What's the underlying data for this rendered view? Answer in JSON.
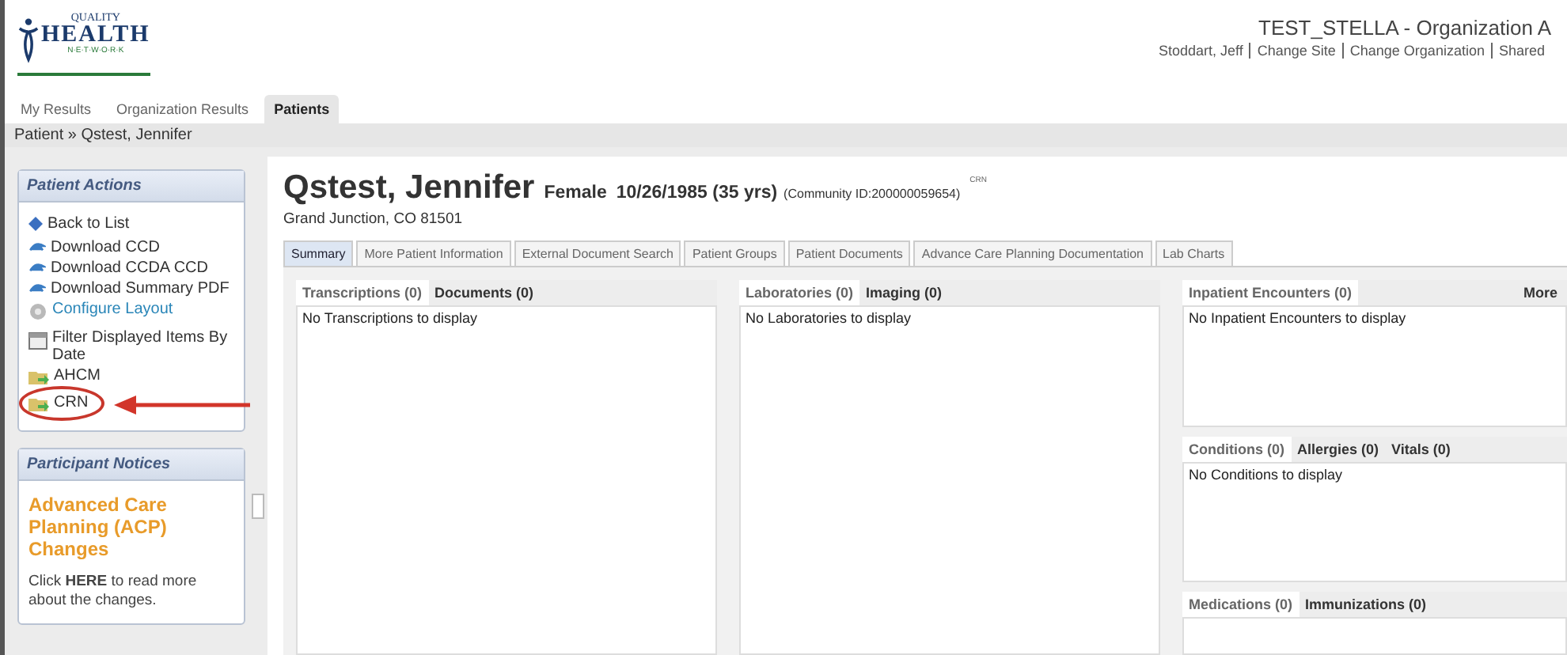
{
  "header": {
    "logo": {
      "top": "QUALITY",
      "middle": "HEALTH",
      "bottom": "N·E·T·W·O·R·K"
    },
    "org_title": "TEST_STELLA - Organization A",
    "user_links": [
      {
        "label": "Stoddart, Jeff"
      },
      {
        "label": "Change Site"
      },
      {
        "label": "Change Organization"
      },
      {
        "label": "Shared"
      }
    ]
  },
  "nav_tabs": [
    {
      "label": "My Results",
      "selected": false
    },
    {
      "label": "Organization Results",
      "selected": false
    },
    {
      "label": "Patients",
      "selected": true
    }
  ],
  "breadcrumb": "Patient » Qstest, Jennifer",
  "sidebar": {
    "actions": {
      "title": "Patient Actions",
      "items": [
        {
          "label": "Back to List",
          "kind": "diamond",
          "link": false,
          "highlighted": false
        },
        {
          "label": "Download CCD",
          "kind": "arrow",
          "link": false,
          "highlighted": false
        },
        {
          "label": "Download CCDA CCD",
          "kind": "arrow",
          "link": false,
          "highlighted": false
        },
        {
          "label": "Download Summary PDF",
          "kind": "arrow",
          "link": false,
          "highlighted": false
        },
        {
          "label": "Configure Layout",
          "kind": "gear",
          "link": true,
          "highlighted": false
        },
        {
          "label": "Filter Displayed Items By Date",
          "kind": "calendar",
          "link": false,
          "highlighted": false
        },
        {
          "label": "AHCM",
          "kind": "folder",
          "link": false,
          "highlighted": false
        },
        {
          "label": "CRN",
          "kind": "folder",
          "link": false,
          "highlighted": true
        }
      ]
    },
    "notices": {
      "title": "Participant Notices",
      "headline": "Advanced Care Planning (ACP) Changes",
      "body": "Click **HERE** to read more about the changes."
    }
  },
  "patient": {
    "name": "Qstest, Jennifer",
    "gender": "Female",
    "dob": "10/26/1985 (35 yrs)",
    "community_id": "(Community ID:200000059654)",
    "badge": "CRN",
    "address": "Grand Junction, CO 81501"
  },
  "tabs": [
    {
      "label": "Summary",
      "selected": true
    },
    {
      "label": "More Patient Information",
      "selected": false
    },
    {
      "label": "External Document Search",
      "selected": false
    },
    {
      "label": "Patient Groups",
      "selected": false
    },
    {
      "label": "Patient Documents",
      "selected": false
    },
    {
      "label": "Advance Care Planning Documentation",
      "selected": false
    },
    {
      "label": "Lab Charts",
      "selected": false
    }
  ],
  "columns": [
    [
      {
        "tabs": [
          {
            "label": "Transcriptions (0)",
            "selected": true
          },
          {
            "label": "Documents (0)",
            "selected": false
          }
        ],
        "empty_text": "No Transcriptions to display"
      }
    ],
    [
      {
        "tabs": [
          {
            "label": "Laboratories (0)",
            "selected": true
          },
          {
            "label": "Imaging (0)",
            "selected": false
          }
        ],
        "empty_text": "No Laboratories to display"
      }
    ],
    [
      {
        "tabs": [
          {
            "label": "Inpatient Encounters (0)",
            "selected": true
          }
        ],
        "more": "More",
        "empty_text": "No Inpatient Encounters to display"
      },
      {
        "tabs": [
          {
            "label": "Conditions (0)",
            "selected": true
          },
          {
            "label": "Allergies (0)",
            "selected": false
          },
          {
            "label": "Vitals (0)",
            "selected": false
          }
        ],
        "empty_text": "No Conditions to display"
      },
      {
        "tabs": [
          {
            "label": "Medications (0)",
            "selected": true
          },
          {
            "label": "Immunizations (0)",
            "selected": false
          }
        ]
      }
    ]
  ]
}
